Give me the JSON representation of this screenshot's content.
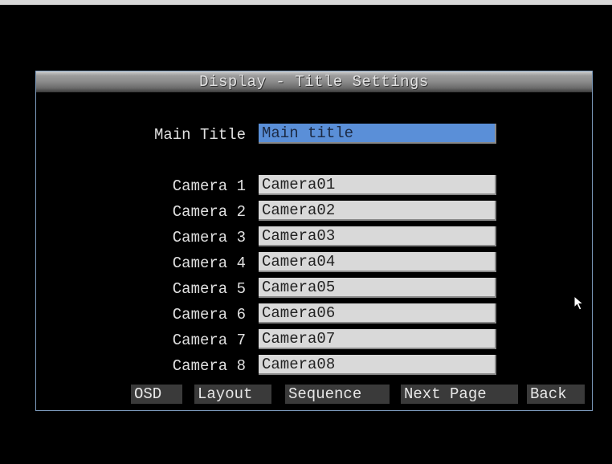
{
  "dialog": {
    "title": "Display - Title Settings"
  },
  "main_title": {
    "label": "Main Title",
    "value": "Main title"
  },
  "cameras": [
    {
      "label": "Camera 1",
      "value": "Camera01"
    },
    {
      "label": "Camera 2",
      "value": "Camera02"
    },
    {
      "label": "Camera 3",
      "value": "Camera03"
    },
    {
      "label": "Camera 4",
      "value": "Camera04"
    },
    {
      "label": "Camera 5",
      "value": "Camera05"
    },
    {
      "label": "Camera 6",
      "value": "Camera06"
    },
    {
      "label": "Camera 7",
      "value": "Camera07"
    },
    {
      "label": "Camera 8",
      "value": "Camera08"
    }
  ],
  "buttons": {
    "osd": "OSD",
    "layout": "Layout",
    "sequence": "Sequence",
    "next_page": "Next Page",
    "back": "Back"
  },
  "colors": {
    "selected_field": "#5a8fd8",
    "field": "#d9d9d9",
    "button": "#3a3a3a",
    "border": "#7f9ec0"
  }
}
